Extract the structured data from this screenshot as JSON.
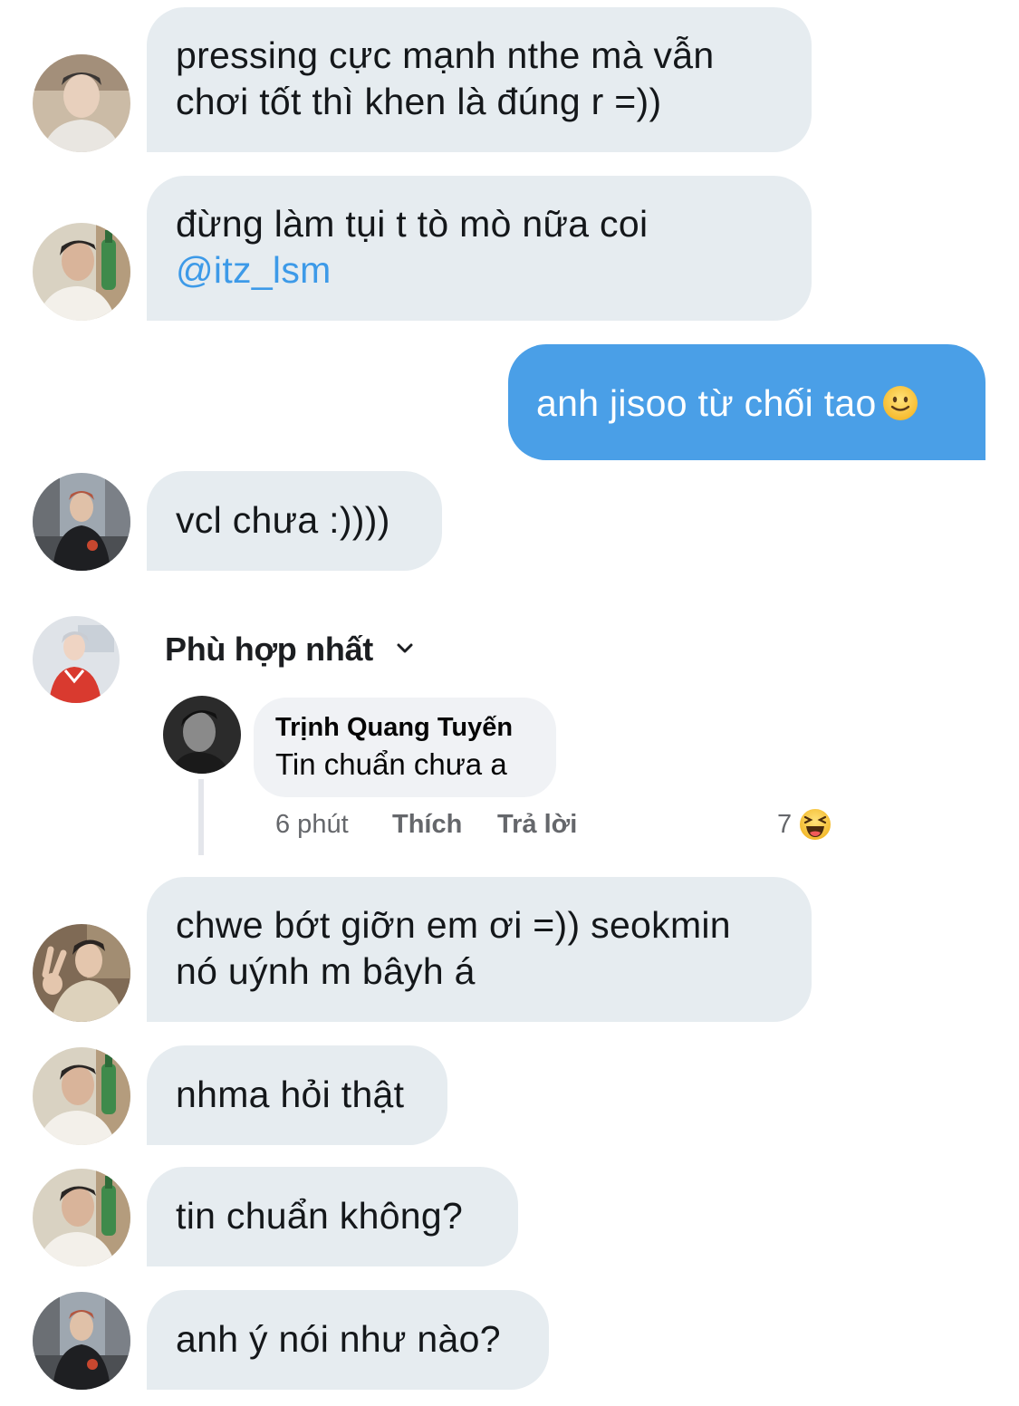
{
  "messages": [
    {
      "avatar": "avatar-light-shirt",
      "lines": [
        "pressing cực mạnh nthe mà vẫn",
        "chơi tốt thì khen là đúng r =))"
      ]
    },
    {
      "avatar": "avatar-bottle",
      "lines": [
        "đừng làm tụi t tò mò nữa coi"
      ],
      "mention": "@itz_lsm"
    },
    {
      "mine": true,
      "text": "anh jisoo từ chối tao",
      "emoji": "slightly-smiling-face"
    },
    {
      "avatar": "avatar-street",
      "lines": [
        "vcl chưa :))))"
      ]
    },
    {
      "avatar": "avatar-red-jersey",
      "embedded_comment": true
    },
    {
      "avatar": "avatar-peace-sign",
      "lines": [
        "chwe bớt giỡn em ơi =)) seokmin",
        "nó uýnh m bâyh á"
      ]
    },
    {
      "avatar": "avatar-bottle",
      "lines": [
        "nhma hỏi thật"
      ]
    },
    {
      "avatar": "avatar-bottle",
      "lines": [
        "tin chuẩn không?"
      ]
    },
    {
      "avatar": "avatar-street",
      "lines": [
        "anh ý nói như nào?"
      ]
    }
  ],
  "embed": {
    "sort_label": "Phù hợp nhất",
    "comment_author": "Trịnh Quang Tuyến",
    "comment_text": "Tin chuẩn chưa a",
    "time": "6 phút",
    "like_label": "Thích",
    "reply_label": "Trả lời",
    "reaction_count": "7",
    "reaction_icon": "haha-emoji"
  },
  "colors": {
    "incoming_bubble": "#e6ecf0",
    "outgoing_bubble": "#4a9fe7",
    "mention": "#3d9ae8"
  }
}
